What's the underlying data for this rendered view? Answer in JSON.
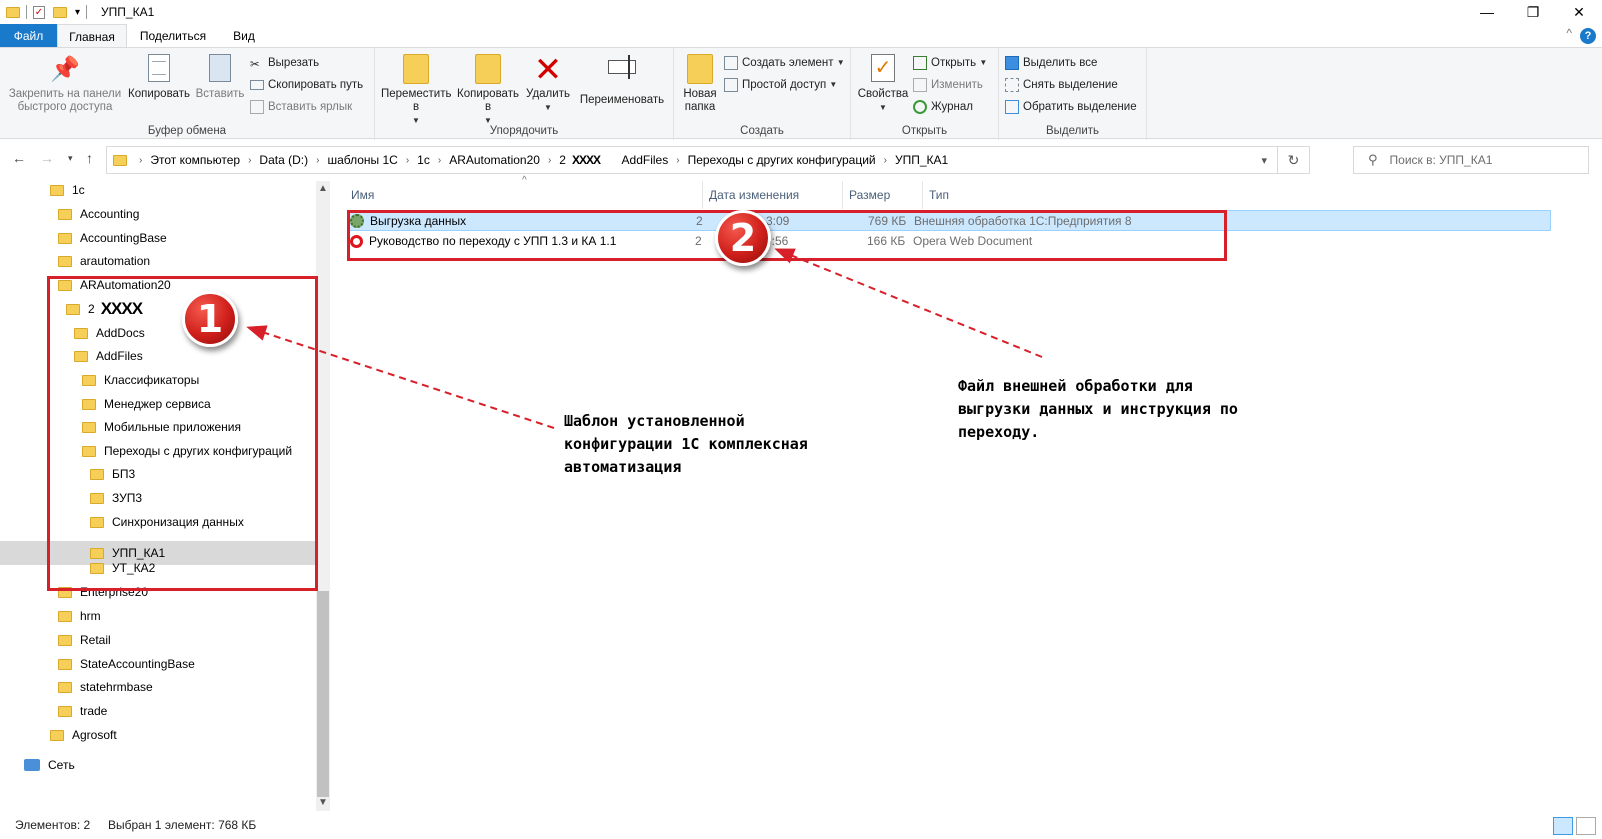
{
  "window": {
    "title": "УПП_КА1",
    "minimize": "—",
    "maximize": "❐",
    "close": "✕"
  },
  "tabs": {
    "file": "Файл",
    "home": "Главная",
    "share": "Поделиться",
    "view": "Вид",
    "help": "?"
  },
  "ribbon": {
    "clipboard": {
      "label": "Буфер обмена",
      "pin": "Закрепить на панели быстрого доступа",
      "copy": "Копировать",
      "paste": "Вставить",
      "cut": "Вырезать",
      "copy_path": "Скопировать путь",
      "paste_shortcut": "Вставить ярлык"
    },
    "organize": {
      "label": "Упорядочить",
      "move": "Переместить в",
      "copy_to": "Копировать в",
      "delete": "Удалить",
      "rename": "Переименовать"
    },
    "create": {
      "label": "Создать",
      "new_folder": "Новая папка",
      "new_item": "Создать элемент",
      "easy_access": "Простой доступ"
    },
    "open": {
      "label": "Открыть",
      "properties": "Свойства",
      "open": "Открыть",
      "edit": "Изменить",
      "history": "Журнал"
    },
    "select": {
      "label": "Выделить",
      "select_all": "Выделить все",
      "select_none": "Снять выделение",
      "invert": "Обратить выделение"
    }
  },
  "address": {
    "crumbs": [
      "Этот компьютер",
      "Data (D:)",
      "шаблоны 1С",
      "1c",
      "ARAutomation20",
      "2",
      "XXXX",
      "AddFiles",
      "Переходы с других конфигураций",
      "УПП_КА1"
    ],
    "search_placeholder": "Поиск в: УПП_КА1"
  },
  "tree": {
    "items": [
      "1c",
      "Accounting",
      "AccountingBase",
      "arautomation",
      "ARAutomation20",
      "2",
      "XXXX",
      "AddDocs",
      "AddFiles",
      "Классификаторы",
      "Менеджер сервиса",
      "Мобильные приложения",
      "Переходы с других конфигураций",
      "БП3",
      "ЗУП3",
      "Синхронизация данных",
      "УПП_КА1",
      "УТ_КА2",
      "Enterprise20",
      "hrm",
      "Retail",
      "StateAccountingBase",
      "statehrmbase",
      "trade",
      "Agrosoft",
      "Сеть"
    ]
  },
  "list": {
    "columns": {
      "name": "Имя",
      "date": "Дата изменения",
      "size": "Размер",
      "type": "Тип"
    },
    "files": [
      {
        "name": "Выгрузка данных",
        "date_start": "2",
        "date_end": "3:09",
        "size": "769 КБ",
        "type": "Внешняя обработка 1С:Предприятия 8"
      },
      {
        "name": "Руководство по переходу с УПП 1.3 и КА 1.1",
        "date_start": "2",
        "date_end": "6:56",
        "size": "166 КБ",
        "type": "Opera Web Document"
      }
    ]
  },
  "status": {
    "count": "Элементов: 2",
    "selected": "Выбран 1 элемент: 768 КБ"
  },
  "annotations": {
    "badge1": "1",
    "badge2": "2",
    "text1": [
      "Шаблон установленной",
      "конфигурации 1С комплексная",
      "автоматизация"
    ],
    "text2": [
      "Файл внешней обработки для",
      "выгрузки данных и инструкция по",
      "переходу."
    ],
    "color": "#d8202a"
  }
}
